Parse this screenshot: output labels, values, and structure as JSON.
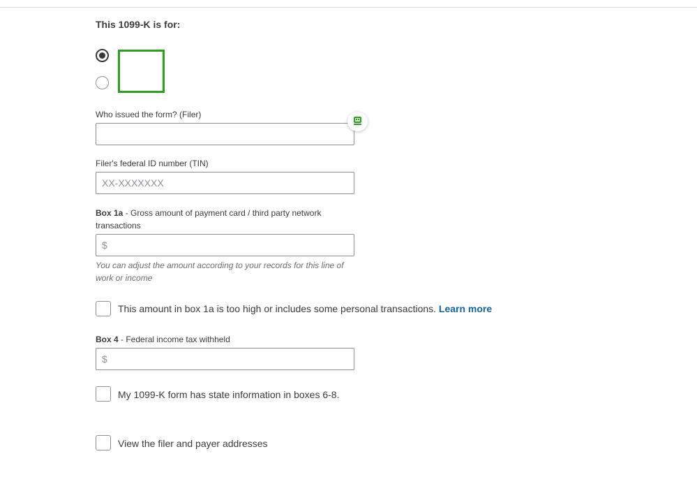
{
  "form": {
    "section_title": "This 1099-K is for:",
    "filer_label": "Who issued the form? (Filer)",
    "filer_value": "",
    "tin_label": "Filer's federal ID number (TIN)",
    "tin_placeholder": "XX-XXXXXXX",
    "box1a_label_bold": "Box 1a",
    "box1a_label_rest": " - Gross amount of payment card / third party network transactions",
    "box1a_placeholder": "$",
    "box1a_hint": "You can adjust the amount according to your records for this line of work or income",
    "box1a_too_high_label": "This amount in box 1a is too high or includes some personal transactions. ",
    "learn_more_label": "Learn more",
    "box4_label_bold": "Box 4",
    "box4_label_rest": " - Federal income tax withheld",
    "box4_placeholder": "$",
    "state_info_label": "My 1099-K form has state information in boxes 6-8.",
    "view_addresses_label": "View the filer and payer addresses"
  },
  "colors": {
    "accent_green": "#2ca01c",
    "link_blue": "#0d66a3"
  },
  "icons": {
    "assist_badge": "autofill-assistant-icon"
  }
}
